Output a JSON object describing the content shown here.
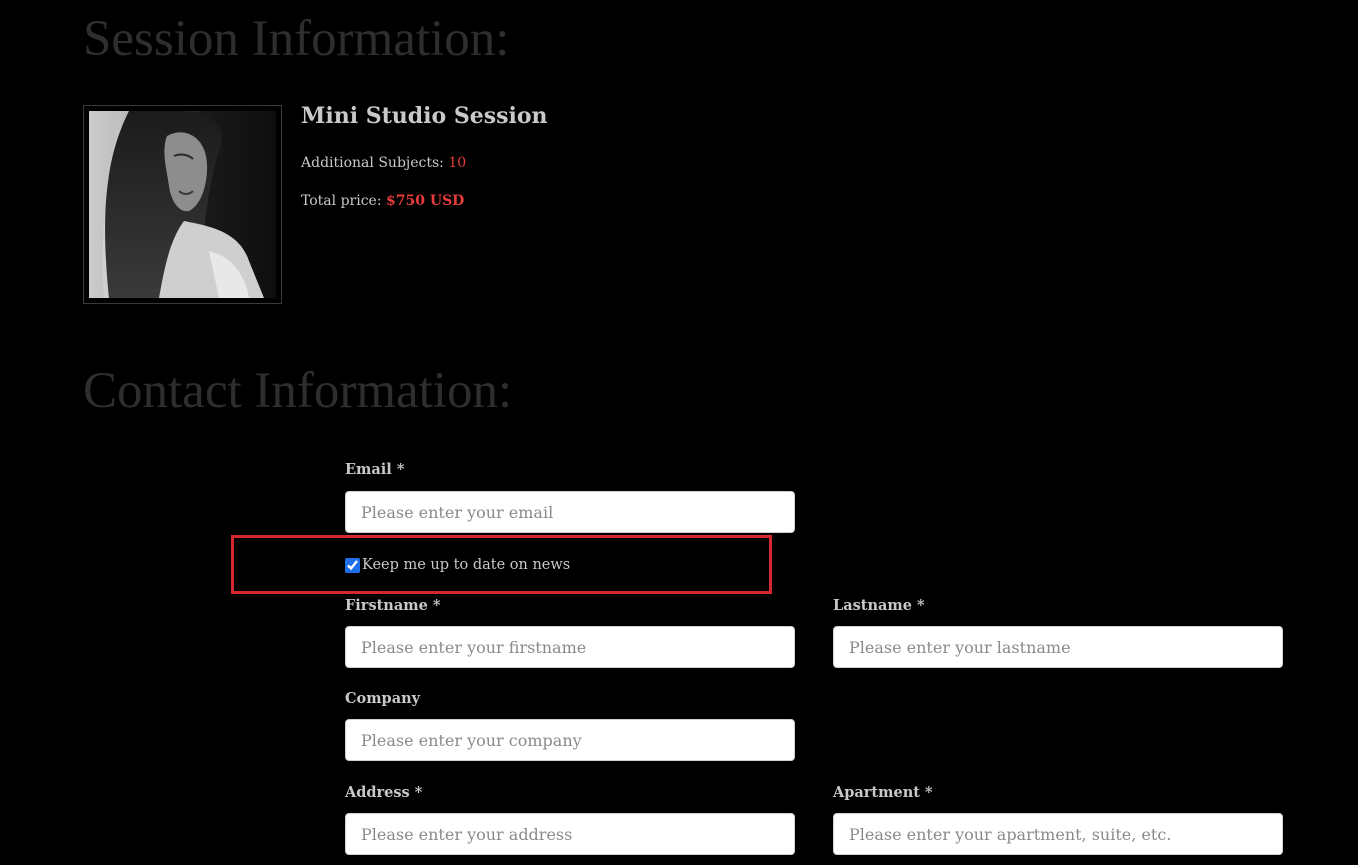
{
  "session": {
    "heading": "Session Information:",
    "title": "Mini Studio Session",
    "subjects_label": "Additional Subjects:",
    "subjects_value": "10",
    "price_label": "Total price:",
    "price_value": "$750 USD"
  },
  "contact": {
    "heading": "Contact Information:",
    "email": {
      "label": "Email *",
      "placeholder": "Please enter your email",
      "value": ""
    },
    "newsletter": {
      "label": "Keep me up to date on news",
      "checked": true
    },
    "firstname": {
      "label": "Firstname *",
      "placeholder": "Please enter your firstname",
      "value": ""
    },
    "lastname": {
      "label": "Lastname *",
      "placeholder": "Please enter your lastname",
      "value": ""
    },
    "company": {
      "label": "Company",
      "placeholder": "Please enter your company",
      "value": ""
    },
    "address": {
      "label": "Address *",
      "placeholder": "Please enter your address",
      "value": ""
    },
    "apartment": {
      "label": "Apartment *",
      "placeholder": "Please enter your apartment, suite, etc.",
      "value": ""
    }
  },
  "colors": {
    "accent": "#e63c3c",
    "highlight": "#d7282f",
    "heading": "#2e2e2e",
    "text": "#c9c9c9",
    "background": "#000000"
  }
}
